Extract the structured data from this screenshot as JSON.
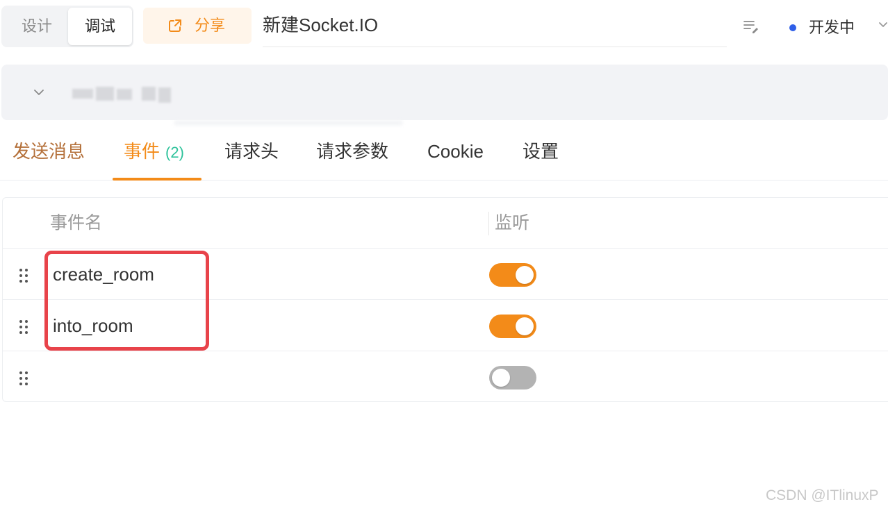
{
  "top_bar": {
    "mode_design": "设计",
    "mode_debug": "调试",
    "active_mode": "调试",
    "share_label": "分享",
    "title_value": "新建Socket.IO",
    "environment": "开发中",
    "environment_dot_color": "#2f5fe8",
    "icons": [
      "share-icon",
      "edit-description-icon",
      "chevron-down-icon"
    ]
  },
  "url_bar": {
    "url_text_redacted": true,
    "icons": [
      "chevron-down-icon"
    ]
  },
  "tabs": [
    {
      "label": "发送消息",
      "active": false
    },
    {
      "label": "事件",
      "count": "(2)",
      "active": true
    },
    {
      "label": "请求头",
      "active": false
    },
    {
      "label": "请求参数",
      "active": false
    },
    {
      "label": "Cookie",
      "active": false
    },
    {
      "label": "设置",
      "active": false
    }
  ],
  "events_table": {
    "columns": [
      "事件名",
      "监听"
    ],
    "rows": [
      {
        "name": "create_room",
        "listening": true
      },
      {
        "name": "into_room",
        "listening": true
      },
      {
        "name": "",
        "listening": false
      }
    ]
  },
  "colors": {
    "accent": "#f38b19",
    "count_badge": "#2ec29b",
    "highlight_border": "#e8434a",
    "toggle_off": "#b3b3b3"
  },
  "watermark": "CSDN @ITlinuxP"
}
